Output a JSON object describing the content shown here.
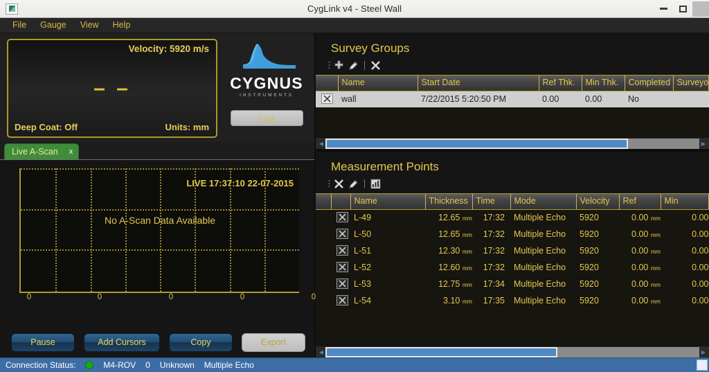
{
  "window": {
    "title": "CygLink v4 - Steel Wall",
    "app_icon": "app-icon",
    "minimize": "minimize-icon",
    "maximize": "maximize-icon"
  },
  "menu": {
    "items": [
      {
        "label": "File"
      },
      {
        "label": "Gauge"
      },
      {
        "label": "View"
      },
      {
        "label": "Help"
      }
    ]
  },
  "gauge": {
    "velocity": "Velocity:  5920 m/s",
    "reading": "– –",
    "deep_coat": "Deep Coat: Off",
    "units": "Units:  mm",
    "brand_name": "CYGNUS",
    "brand_sub": "INSTRUMENTS",
    "log_button": "Log"
  },
  "ascan": {
    "tab_label": "Live A-Scan",
    "tab_close": "x",
    "live_stamp": "LIVE 17:37:10 22-07-2015",
    "no_data": "No A-Scan Data Available",
    "x_ticks": [
      "0",
      "0",
      "0",
      "0",
      "0"
    ],
    "buttons": [
      {
        "label": "Pause",
        "disabled": false
      },
      {
        "label": "Add Cursors",
        "disabled": false
      },
      {
        "label": "Copy",
        "disabled": false
      },
      {
        "label": "Export",
        "disabled": true
      }
    ]
  },
  "survey_groups": {
    "title": "Survey Groups",
    "toolbar": [
      {
        "name": "add-group-icon"
      },
      {
        "name": "edit-group-icon"
      },
      {
        "name": "delete-group-icon"
      }
    ],
    "columns": [
      "",
      "Name",
      "Start Date",
      "Ref Thk.",
      "Min Thk.",
      "Completed",
      "Surveyor"
    ],
    "rows": [
      {
        "selected": true,
        "name": "wall",
        "start_date": "7/22/2015 5:20:50 PM",
        "ref_thk": "0.00",
        "min_thk": "0.00",
        "completed": "No",
        "surveyor": ""
      }
    ],
    "scroll": {
      "thumb_percent": 81,
      "offset_percent": 0
    }
  },
  "measurement_points": {
    "title": "Measurement Points",
    "toolbar": [
      {
        "name": "delete-point-icon"
      },
      {
        "name": "edit-point-icon"
      },
      {
        "name": "chart-icon"
      }
    ],
    "columns": [
      "",
      "",
      "Name",
      "Thickness",
      "Time",
      "Mode",
      "Velocity",
      "Ref",
      "Min"
    ],
    "rows": [
      {
        "name": "L-49",
        "thickness": "12.65",
        "thickness_unit": "mm",
        "time": "17:32",
        "mode": "Multiple Echo",
        "velocity": "5920",
        "ref": "0.00",
        "ref_unit": "mm",
        "min": "0.00"
      },
      {
        "name": "L-50",
        "thickness": "12.65",
        "thickness_unit": "mm",
        "time": "17:32",
        "mode": "Multiple Echo",
        "velocity": "5920",
        "ref": "0.00",
        "ref_unit": "mm",
        "min": "0.00"
      },
      {
        "name": "L-51",
        "thickness": "12.30",
        "thickness_unit": "mm",
        "time": "17:32",
        "mode": "Multiple Echo",
        "velocity": "5920",
        "ref": "0.00",
        "ref_unit": "mm",
        "min": "0.00"
      },
      {
        "name": "L-52",
        "thickness": "12.60",
        "thickness_unit": "mm",
        "time": "17:32",
        "mode": "Multiple Echo",
        "velocity": "5920",
        "ref": "0.00",
        "ref_unit": "mm",
        "min": "0.00"
      },
      {
        "name": "L-53",
        "thickness": "12.75",
        "thickness_unit": "mm",
        "time": "17:34",
        "mode": "Multiple Echo",
        "velocity": "5920",
        "ref": "0.00",
        "ref_unit": "mm",
        "min": "0.00"
      },
      {
        "name": "L-54",
        "thickness": "3.10",
        "thickness_unit": "mm",
        "time": "17:35",
        "mode": "Multiple Echo",
        "velocity": "5920",
        "ref": "0.00",
        "ref_unit": "mm",
        "min": "0.00"
      }
    ],
    "scroll": {
      "thumb_percent": 62,
      "offset_percent": 0
    }
  },
  "status_bar": {
    "label": "Connection Status:",
    "indicator_color": "#17a81a",
    "device": "M4-ROV",
    "count": "0",
    "state": "Unknown",
    "mode": "Multiple Echo"
  },
  "colors": {
    "accent_yellow": "#e3c94f",
    "panel_bg": "#1b1b1b",
    "status_blue": "#3c6ea5",
    "tab_green": "#3f8c3a"
  }
}
